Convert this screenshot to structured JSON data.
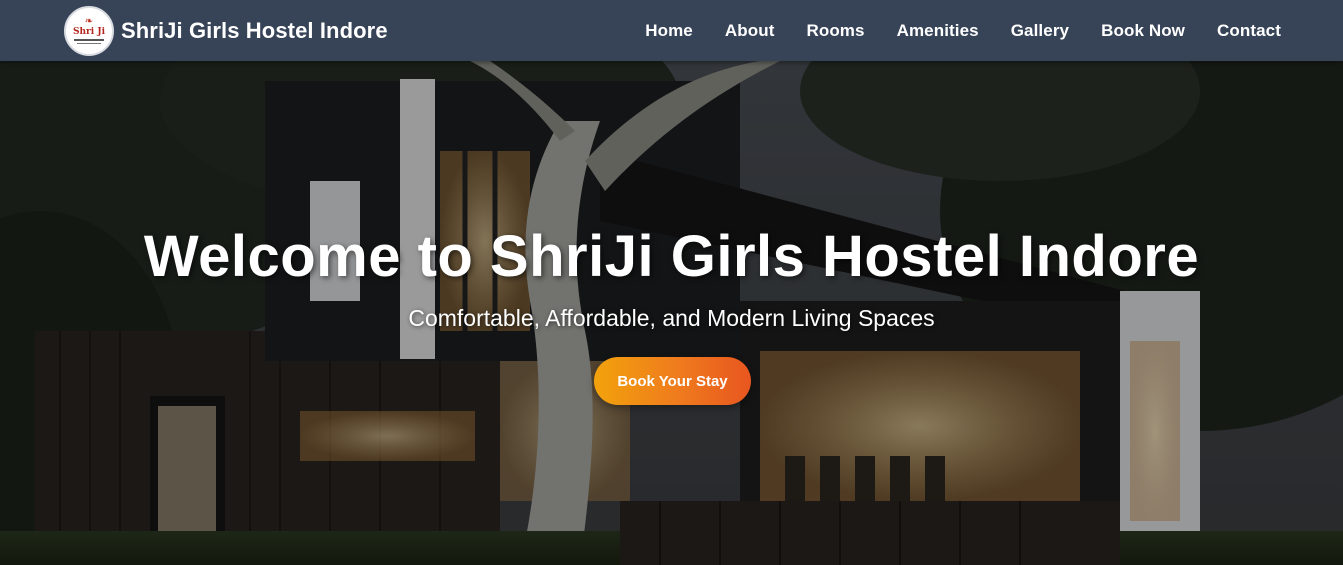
{
  "brand": {
    "name": "ShriJi Girls Hostel Indore",
    "logo_text": "Shri Ji"
  },
  "nav": {
    "items": [
      {
        "label": "Home"
      },
      {
        "label": "About"
      },
      {
        "label": "Rooms"
      },
      {
        "label": "Amenities"
      },
      {
        "label": "Gallery"
      },
      {
        "label": "Book Now"
      },
      {
        "label": "Contact"
      }
    ]
  },
  "hero": {
    "title": "Welcome to ShriJi Girls Hostel Indore",
    "subtitle": "Comfortable, Affordable, and Modern Living Spaces",
    "cta_label": "Book Your Stay"
  },
  "colors": {
    "navbar_bg": "#374357",
    "nav_text": "#ffffff",
    "cta_gradient_start": "#f2a20c",
    "cta_gradient_end": "#e8561f",
    "logo_accent": "#b3261e"
  }
}
